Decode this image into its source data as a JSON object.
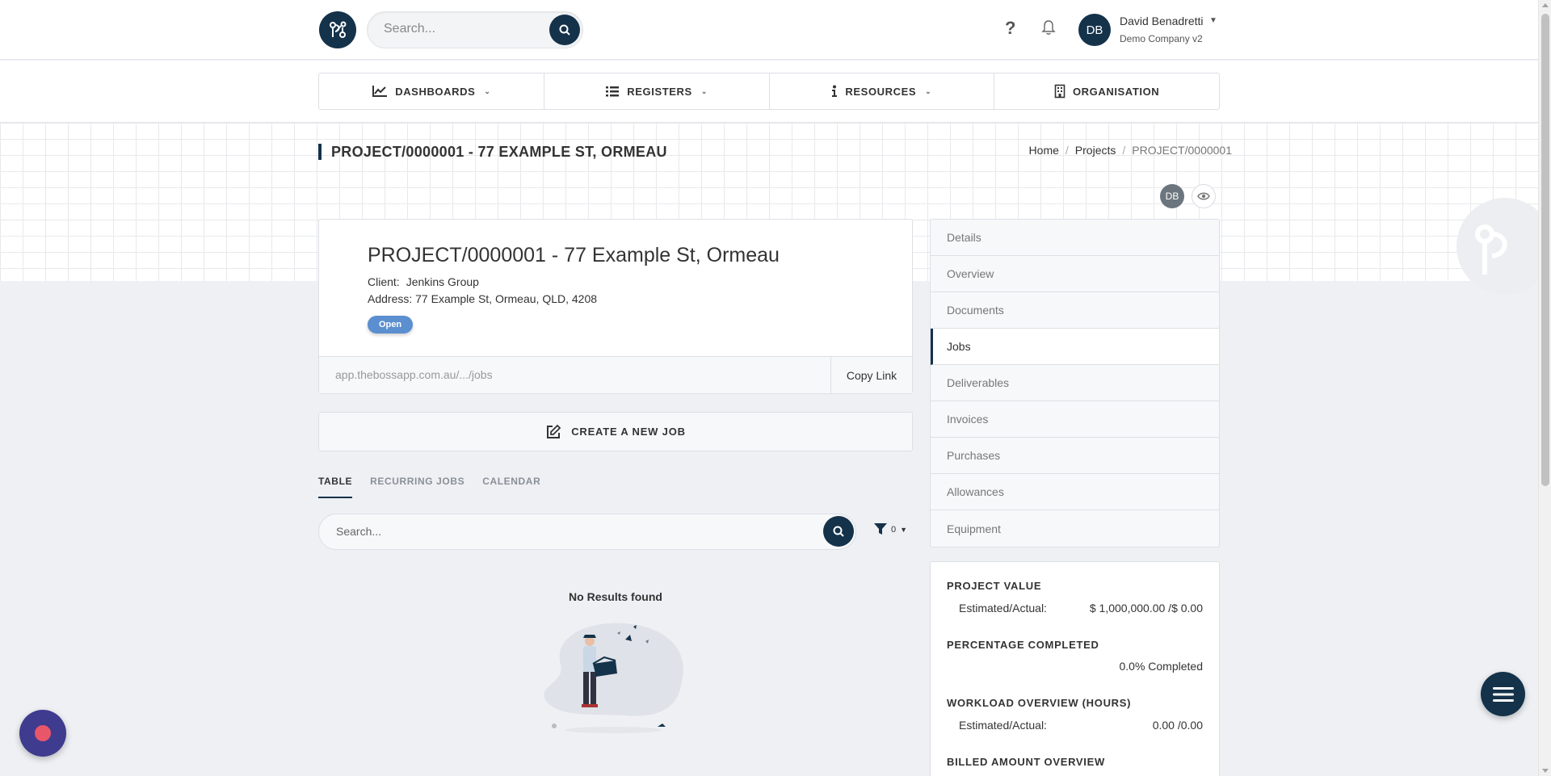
{
  "header": {
    "search_placeholder": "Search...",
    "help_label": "?",
    "user": {
      "initials": "DB",
      "name": "David Benadretti",
      "company": "Demo Company v2"
    }
  },
  "nav": {
    "items": [
      {
        "label": "DASHBOARDS",
        "icon": "chart-line-icon",
        "has_dropdown": true
      },
      {
        "label": "REGISTERS",
        "icon": "list-icon",
        "has_dropdown": true
      },
      {
        "label": "RESOURCES",
        "icon": "info-icon",
        "has_dropdown": true
      },
      {
        "label": "ORGANISATION",
        "icon": "building-icon",
        "has_dropdown": false
      }
    ]
  },
  "page": {
    "title": "PROJECT/0000001 - 77 EXAMPLE ST, ORMEAU",
    "breadcrumb": {
      "home": "Home",
      "projects": "Projects",
      "current": "PROJECT/0000001"
    },
    "watcher_initials": "DB"
  },
  "project": {
    "heading": "PROJECT/0000001 - 77 Example St, Ormeau",
    "client_label": "Client:",
    "client_value": "Jenkins Group",
    "address": "Address: 77 Example St, Ormeau, QLD, 4208",
    "status": "Open",
    "link": "app.thebossapp.com.au/.../jobs",
    "copy_link_label": "Copy Link"
  },
  "create_job_label": "CREATE A NEW JOB",
  "tabs": [
    {
      "label": "TABLE",
      "active": true
    },
    {
      "label": "RECURRING JOBS",
      "active": false
    },
    {
      "label": "CALENDAR",
      "active": false
    }
  ],
  "jobs_search_placeholder": "Search...",
  "filter_count": "0",
  "no_results_text": "No Results found",
  "side_menu": [
    {
      "label": "Details",
      "active": false
    },
    {
      "label": "Overview",
      "active": false
    },
    {
      "label": "Documents",
      "active": false
    },
    {
      "label": "Jobs",
      "active": true
    },
    {
      "label": "Deliverables",
      "active": false
    },
    {
      "label": "Invoices",
      "active": false
    },
    {
      "label": "Purchases",
      "active": false
    },
    {
      "label": "Allowances",
      "active": false
    },
    {
      "label": "Equipment",
      "active": false
    }
  ],
  "summary": {
    "project_value": {
      "heading": "PROJECT VALUE",
      "label": "Estimated/Actual:",
      "value": "$ 1,000,000.00 /$ 0.00"
    },
    "percentage": {
      "heading": "PERCENTAGE COMPLETED",
      "value": "0.0% Completed"
    },
    "workload": {
      "heading": "WORKLOAD OVERVIEW (HOURS)",
      "label": "Estimated/Actual:",
      "value": "0.00 /0.00"
    },
    "billed": {
      "heading": "BILLED AMOUNT OVERVIEW"
    }
  },
  "colors": {
    "primary": "#14324a",
    "status_open": "#5b8fcf",
    "record_button": "#3f3b8e",
    "record_dot": "#e8566a"
  }
}
